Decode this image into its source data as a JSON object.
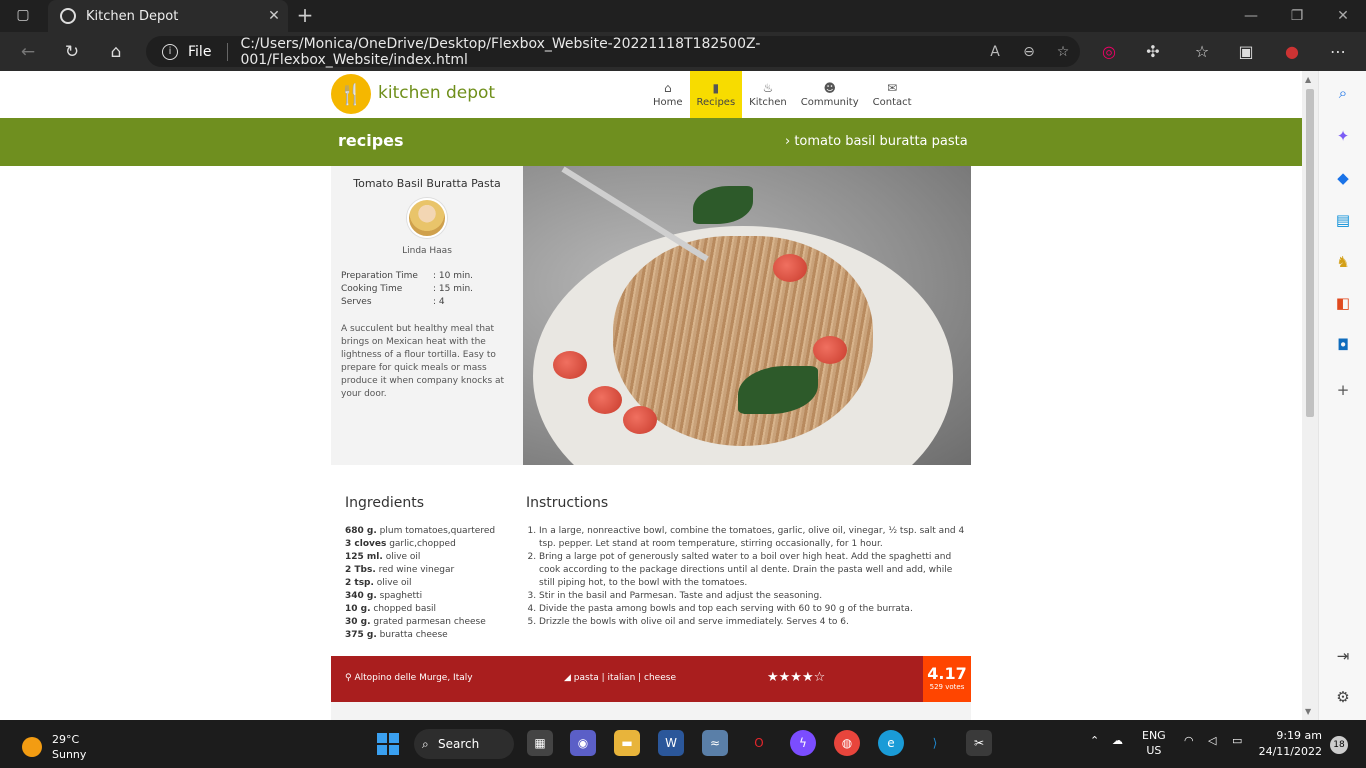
{
  "browser": {
    "tab_title": "Kitchen Depot",
    "file_label": "File",
    "url": "C:/Users/Monica/OneDrive/Desktop/Flexbox_Website-20221118T182500Z-001/Flexbox_Website/index.html"
  },
  "site": {
    "logo_text": "kitchen depot",
    "nav": [
      {
        "label": "Home",
        "icon": "home-icon"
      },
      {
        "label": "Recipes",
        "icon": "book-icon"
      },
      {
        "label": "Kitchen",
        "icon": "pot-icon"
      },
      {
        "label": "Community",
        "icon": "people-icon"
      },
      {
        "label": "Contact",
        "icon": "chat-icon"
      }
    ],
    "active_nav": "Recipes"
  },
  "banner": {
    "title": "recipes",
    "breadcrumb": "› tomato basil buratta pasta"
  },
  "recipe": {
    "title": "Tomato Basil Buratta Pasta",
    "author": "Linda Haas",
    "meta": [
      {
        "label": "Preparation Time",
        "value": ": 10 min."
      },
      {
        "label": "Cooking Time",
        "value": ": 15 min."
      },
      {
        "label": "Serves",
        "value": ": 4"
      }
    ],
    "description": "A succulent but healthy meal that brings on Mexican heat with the lightness of a flour tortilla. Easy to prepare for quick meals or mass produce it when company knocks at your door."
  },
  "ingredients": {
    "heading": "Ingredients",
    "items": [
      {
        "qty": "680 g.",
        "name": "plum tomatoes,quartered"
      },
      {
        "qty": "3 cloves",
        "name": "garlic,chopped"
      },
      {
        "qty": "125 ml.",
        "name": "olive oil"
      },
      {
        "qty": "2 Tbs.",
        "name": "red wine vinegar"
      },
      {
        "qty": "2 tsp.",
        "name": "olive oil"
      },
      {
        "qty": "340 g.",
        "name": "spaghetti"
      },
      {
        "qty": "10 g.",
        "name": "chopped basil"
      },
      {
        "qty": "30 g.",
        "name": "grated parmesan cheese"
      },
      {
        "qty": "375 g.",
        "name": "buratta cheese"
      }
    ]
  },
  "instructions": {
    "heading": "Instructions",
    "steps": [
      "In a large, nonreactive bowl, combine the tomatoes, garlic, olive oil, vinegar, ½ tsp. salt and 4 tsp. pepper. Let stand at room temperature, stirring occasionally, for 1 hour.",
      "Bring a large pot of generously salted water to a boil over high heat. Add the spaghetti and cook according to the package directions until al dente. Drain the pasta well and add, while still piping hot, to the bowl with the tomatoes.",
      "Stir in the basil and Parmesan. Taste and adjust the seasoning.",
      "Divide the pasta among bowls and top each serving with 60 to 90 g of the burrata.",
      "Drizzle the bowls with olive oil and serve immediately. Serves 4 to 6."
    ]
  },
  "footer": {
    "location": "Altopino delle Murge, Italy",
    "tags": "pasta | italian | cheese",
    "stars": "★★★★☆",
    "rating": "4.17",
    "votes": "529 votes"
  },
  "taskbar": {
    "temp": "29°C",
    "weather": "Sunny",
    "search": "Search",
    "lang1": "ENG",
    "lang2": "US",
    "time": "9:19 am",
    "date": "24/11/2022",
    "notifications": "18"
  }
}
